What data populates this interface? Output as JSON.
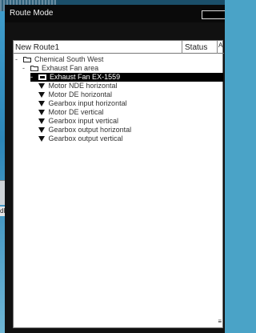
{
  "window": {
    "title": "Route Mode"
  },
  "background": {
    "left_fragment": "dle"
  },
  "table": {
    "col_route": "New Route1",
    "col_status": "Status",
    "corner": "A",
    "scroll_mark": "≡"
  },
  "tree": [
    {
      "label": "Chemical South West",
      "expander": "-",
      "icon": "folder-icon",
      "selected": false
    },
    {
      "label": "Exhaust Fan area",
      "expander": "-",
      "icon": "folder-icon",
      "selected": false
    },
    {
      "label": "Exhaust Fan EX-1559",
      "expander": "-",
      "icon": "machine-icon",
      "selected": true
    },
    {
      "label": "Motor NDE horizontal",
      "icon": "measurement-point-icon"
    },
    {
      "label": "Motor DE horizontal",
      "icon": "measurement-point-icon"
    },
    {
      "label": "Gearbox input horizontal",
      "icon": "measurement-point-icon"
    },
    {
      "label": "Motor DE vertical",
      "icon": "measurement-point-icon"
    },
    {
      "label": "Gearbox input vertical",
      "icon": "measurement-point-icon"
    },
    {
      "label": "Gearbox output horizontal",
      "icon": "measurement-point-icon"
    },
    {
      "label": "Gearbox output vertical",
      "icon": "measurement-point-icon"
    }
  ]
}
